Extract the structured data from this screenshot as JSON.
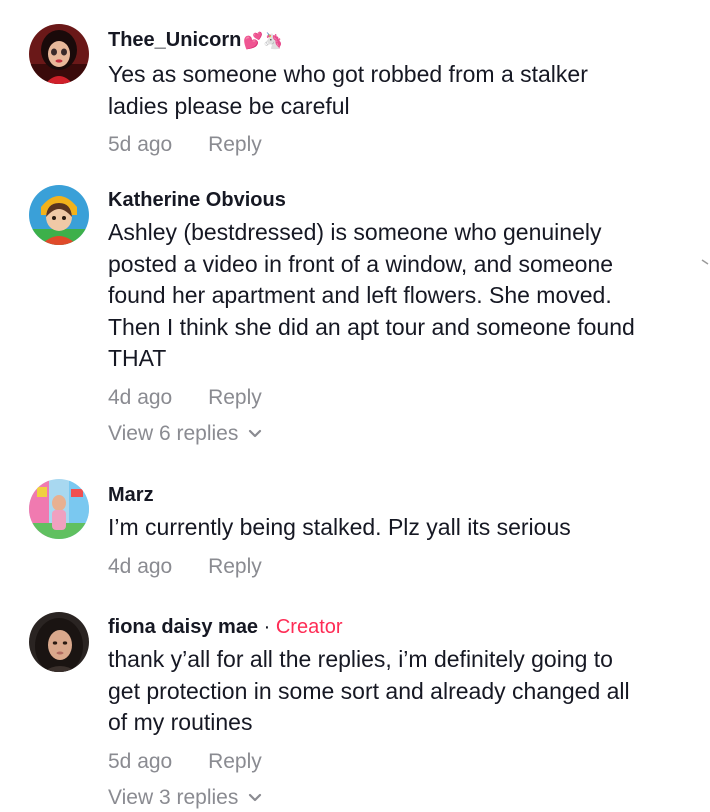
{
  "comments": [
    {
      "username": "Thee_Unicorn",
      "username_emoji": "💕🦄",
      "text": "Yes as someone who got robbed from a stalker\nladies please be careful",
      "time": "5d ago",
      "reply_label": "Reply",
      "avatar_icon": "avatar-doll-icon"
    },
    {
      "username": "Katherine Obvious",
      "text": "Ashley (bestdressed) is someone who genuinely\nposted a video in front of a window, and someone\nfound her apartment and left flowers. She moved.\nThen I think she did an apt tour and someone found\nTHAT",
      "time": "4d ago",
      "reply_label": "Reply",
      "view_replies": "View 6 replies",
      "avatar_icon": "avatar-3d-character-icon"
    },
    {
      "username": "Marz",
      "text": "I’m currently being stalked. Plz yall its serious",
      "time": "4d ago",
      "reply_label": "Reply",
      "avatar_icon": "avatar-colorful-room-icon"
    },
    {
      "username": "fiona daisy mae",
      "separator": " · ",
      "creator_badge": "Creator",
      "text": "thank y’all for all the replies, i’m definitely going to\nget protection in some sort and already changed all\nof my routines",
      "time": "5d ago",
      "reply_label": "Reply",
      "view_replies": "View 3 replies",
      "avatar_icon": "avatar-portrait-icon"
    }
  ],
  "colors": {
    "text": "#161823",
    "muted": "#8a8b91",
    "creator": "#fe2c55"
  }
}
